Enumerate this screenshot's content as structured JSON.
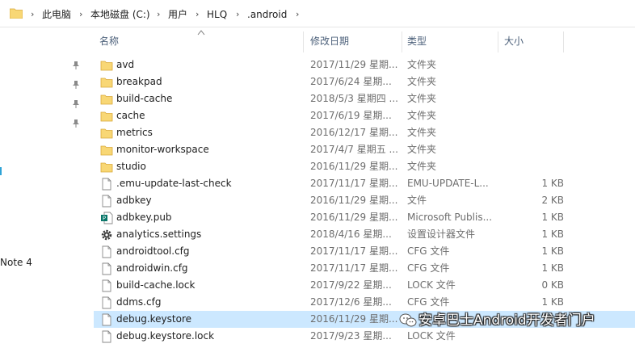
{
  "breadcrumb": {
    "items": [
      "此电脑",
      "本地磁盘 (C:)",
      "用户",
      "HLQ",
      ".android"
    ]
  },
  "nav": {
    "item_partial_label": "Note 4"
  },
  "columns": {
    "name": "名称",
    "date": "修改日期",
    "type": "类型",
    "size": "大小"
  },
  "files": [
    {
      "name": "avd",
      "date": "2017/11/29 星期...",
      "type": "文件夹",
      "size": "",
      "icon": "folder-icon"
    },
    {
      "name": "breakpad",
      "date": "2017/6/24 星期...",
      "type": "文件夹",
      "size": "",
      "icon": "folder-icon"
    },
    {
      "name": "build-cache",
      "date": "2018/5/3 星期四 ...",
      "type": "文件夹",
      "size": "",
      "icon": "folder-icon"
    },
    {
      "name": "cache",
      "date": "2017/6/19 星期...",
      "type": "文件夹",
      "size": "",
      "icon": "folder-icon"
    },
    {
      "name": "metrics",
      "date": "2016/12/17 星期...",
      "type": "文件夹",
      "size": "",
      "icon": "folder-icon"
    },
    {
      "name": "monitor-workspace",
      "date": "2017/4/7 星期五 ...",
      "type": "文件夹",
      "size": "",
      "icon": "folder-icon"
    },
    {
      "name": "studio",
      "date": "2016/11/29 星期...",
      "type": "文件夹",
      "size": "",
      "icon": "folder-icon"
    },
    {
      "name": ".emu-update-last-check",
      "date": "2017/11/17 星期...",
      "type": "EMU-UPDATE-L...",
      "size": "1 KB",
      "icon": "file-icon"
    },
    {
      "name": "adbkey",
      "date": "2016/11/29 星期...",
      "type": "文件",
      "size": "2 KB",
      "icon": "file-icon"
    },
    {
      "name": "adbkey.pub",
      "date": "2016/11/29 星期...",
      "type": "Microsoft Publis...",
      "size": "1 KB",
      "icon": "publisher-file-icon"
    },
    {
      "name": "analytics.settings",
      "date": "2018/4/16 星期...",
      "type": "设置设计器文件",
      "size": "1 KB",
      "icon": "settings-gear-icon"
    },
    {
      "name": "androidtool.cfg",
      "date": "2017/11/17 星期...",
      "type": "CFG 文件",
      "size": "1 KB",
      "icon": "file-icon"
    },
    {
      "name": "androidwin.cfg",
      "date": "2017/11/17 星期...",
      "type": "CFG 文件",
      "size": "1 KB",
      "icon": "file-icon"
    },
    {
      "name": "build-cache.lock",
      "date": "2017/9/22 星期...",
      "type": "LOCK 文件",
      "size": "0 KB",
      "icon": "file-icon"
    },
    {
      "name": "ddms.cfg",
      "date": "2017/12/6 星期...",
      "type": "CFG 文件",
      "size": "1 KB",
      "icon": "file-icon"
    },
    {
      "name": "debug.keystore",
      "date": "2016/11/29 星期...",
      "type": "",
      "size": "",
      "icon": "file-icon",
      "selected": true
    },
    {
      "name": "debug.keystore.lock",
      "date": "2017/9/23 星期...",
      "type": "LOCK 文件",
      "size": "",
      "icon": "file-icon"
    }
  ],
  "watermark": {
    "text": "安卓巴士Android开发者门户"
  },
  "colors": {
    "selection": "#cce8ff",
    "folder": "#f8d775",
    "header_text": "#4c607a"
  }
}
